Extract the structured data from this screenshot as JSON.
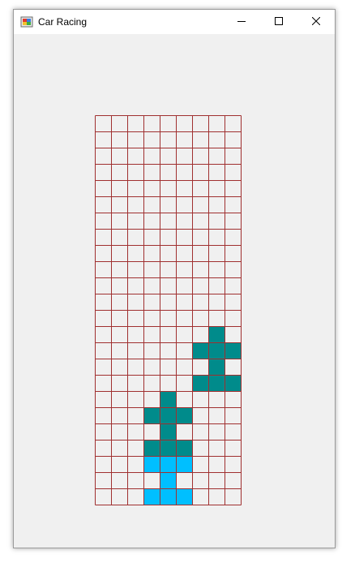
{
  "window": {
    "title": "Car Racing",
    "icon": "winforms-app-icon",
    "controls": [
      "minimize-icon",
      "maximize-icon",
      "close-icon"
    ]
  },
  "game": {
    "grid_columns": 9,
    "grid_rows": 24,
    "colors": {
      "grid_line": "#a03030",
      "cell_background": "#f0f0f0",
      "enemy_car": "#008b8b",
      "player_car": "#00bfff"
    },
    "cars": [
      {
        "role": "enemy",
        "color": "#008b8b",
        "cells": [
          [
            7,
            13
          ],
          [
            6,
            14
          ],
          [
            7,
            14
          ],
          [
            8,
            14
          ],
          [
            7,
            15
          ],
          [
            6,
            16
          ],
          [
            7,
            16
          ],
          [
            8,
            16
          ]
        ]
      },
      {
        "role": "enemy",
        "color": "#008b8b",
        "cells": [
          [
            4,
            17
          ],
          [
            3,
            18
          ],
          [
            4,
            18
          ],
          [
            5,
            18
          ],
          [
            4,
            19
          ],
          [
            3,
            20
          ],
          [
            4,
            20
          ],
          [
            5,
            20
          ]
        ]
      },
      {
        "role": "player",
        "color": "#00bfff",
        "cells": [
          [
            3,
            21
          ],
          [
            4,
            21
          ],
          [
            5,
            21
          ],
          [
            4,
            22
          ],
          [
            3,
            23
          ],
          [
            4,
            23
          ],
          [
            5,
            23
          ]
        ]
      }
    ]
  }
}
